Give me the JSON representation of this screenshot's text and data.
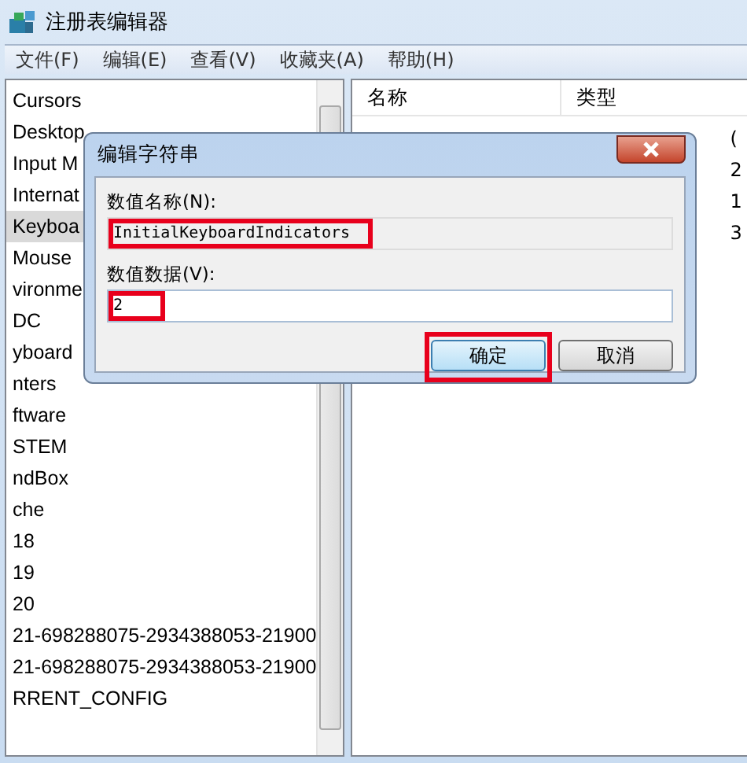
{
  "window": {
    "title": "注册表编辑器"
  },
  "menu": [
    "文件(F)",
    "编辑(E)",
    "查看(V)",
    "收藏夹(A)",
    "帮助(H)"
  ],
  "tree": [
    {
      "label": "Cursors",
      "selected": false
    },
    {
      "label": "Desktop",
      "selected": false
    },
    {
      "label": "Input M",
      "selected": false
    },
    {
      "label": "Internat",
      "selected": false
    },
    {
      "label": "Keyboa",
      "selected": true
    },
    {
      "label": "Mouse",
      "selected": false
    },
    {
      "label": "vironme",
      "selected": false
    },
    {
      "label": "DC",
      "selected": false
    },
    {
      "label": "yboard",
      "selected": false
    },
    {
      "label": "nters",
      "selected": false
    },
    {
      "label": "ftware",
      "selected": false
    },
    {
      "label": "STEM",
      "selected": false
    },
    {
      "label": "ndBox",
      "selected": false
    },
    {
      "label": "che",
      "selected": false
    },
    {
      "label": "18",
      "selected": false
    },
    {
      "label": "19",
      "selected": false
    },
    {
      "label": "20",
      "selected": false
    },
    {
      "label": "21-698288075-2934388053-21900",
      "selected": false
    },
    {
      "label": "21-698288075-2934388053-21900",
      "selected": false
    },
    {
      "label": "RRENT_CONFIG",
      "selected": false
    }
  ],
  "table": {
    "columns": [
      "名称",
      "类型"
    ],
    "column_3_values": [
      "(",
      "2",
      "1",
      "3"
    ]
  },
  "dialog": {
    "title": "编辑字符串",
    "name_label": "数值名称(N):",
    "name_value": "InitialKeyboardIndicators",
    "name_highlighted": true,
    "data_label": "数值数据(V):",
    "data_value": "2",
    "data_highlighted": true,
    "buttons": [
      {
        "label": "确定",
        "default": true,
        "highlighted": true
      },
      {
        "label": "取消",
        "default": false,
        "highlighted": false
      }
    ]
  }
}
